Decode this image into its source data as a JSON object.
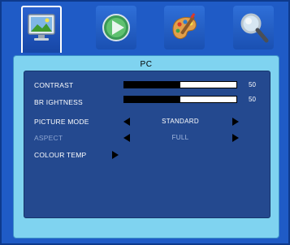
{
  "icon_bar": {
    "items": [
      {
        "icon": "picture-monitor-icon",
        "active": true
      },
      {
        "icon": "play-disc-icon",
        "active": false
      },
      {
        "icon": "paint-palette-icon",
        "active": false
      },
      {
        "icon": "magnifier-icon",
        "active": false
      }
    ]
  },
  "panel": {
    "title": "PC",
    "contrast": {
      "label": "CONTRAST",
      "value": "50",
      "level": 0.5
    },
    "brightness": {
      "label": "BR IGHTNESS",
      "value": "50",
      "level": 0.5
    },
    "picture_mode": {
      "label": "PICTURE MODE",
      "value": "STANDARD"
    },
    "aspect": {
      "label": "ASPECT",
      "value": "FULL"
    },
    "colour_temp": {
      "label": "COLOUR TEMP"
    }
  },
  "colors": {
    "background": "#1f5bc6",
    "panel": "#7fd3f0",
    "inner_panel": "#24498f",
    "text": "#ffffff",
    "dim_text": "#8ea6d2"
  }
}
